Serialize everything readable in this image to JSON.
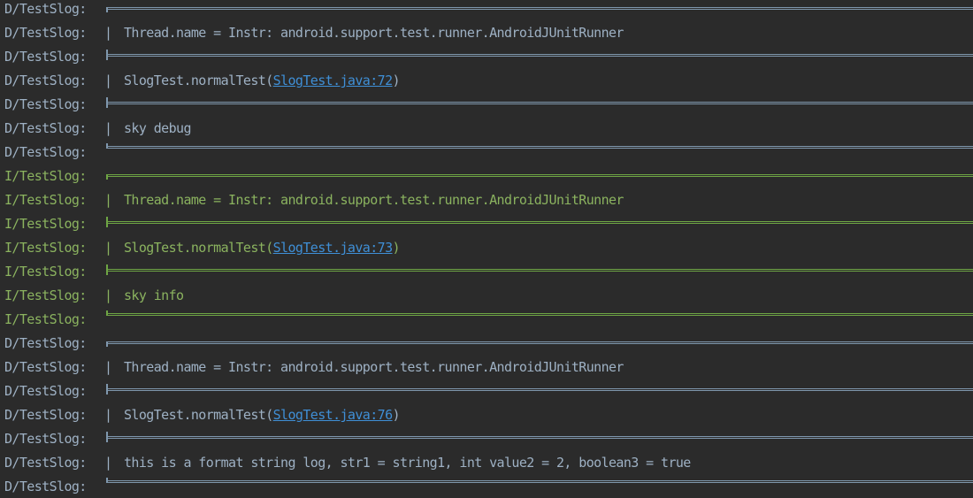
{
  "colors": {
    "background": "#2b2b2b",
    "debug_text": "#9eb1c4",
    "info_text": "#8bb35f",
    "link": "#3f8fd6"
  },
  "log_lines": [
    {
      "level": "D",
      "tag": "D/TestSlog:",
      "kind": "border-top"
    },
    {
      "level": "D",
      "tag": "D/TestSlog:",
      "kind": "text",
      "text": "Thread.name = Instr: android.support.test.runner.AndroidJUnitRunner"
    },
    {
      "level": "D",
      "tag": "D/TestSlog:",
      "kind": "border-mid"
    },
    {
      "level": "D",
      "tag": "D/TestSlog:",
      "kind": "stack",
      "text": "SlogTest.normalTest",
      "link_open": "(",
      "link": "SlogTest.java:72",
      "link_close": ")"
    },
    {
      "level": "D",
      "tag": "D/TestSlog:",
      "kind": "border-mid"
    },
    {
      "level": "D",
      "tag": "D/TestSlog:",
      "kind": "text",
      "text": "sky debug"
    },
    {
      "level": "D",
      "tag": "D/TestSlog:",
      "kind": "border-bottom"
    },
    {
      "level": "I",
      "tag": "I/TestSlog:",
      "kind": "border-top"
    },
    {
      "level": "I",
      "tag": "I/TestSlog:",
      "kind": "text",
      "text": "Thread.name = Instr: android.support.test.runner.AndroidJUnitRunner"
    },
    {
      "level": "I",
      "tag": "I/TestSlog:",
      "kind": "border-mid"
    },
    {
      "level": "I",
      "tag": "I/TestSlog:",
      "kind": "stack",
      "text": "SlogTest.normalTest",
      "link_open": "(",
      "link": "SlogTest.java:73",
      "link_close": ")"
    },
    {
      "level": "I",
      "tag": "I/TestSlog:",
      "kind": "border-mid"
    },
    {
      "level": "I",
      "tag": "I/TestSlog:",
      "kind": "text",
      "text": "sky info"
    },
    {
      "level": "I",
      "tag": "I/TestSlog:",
      "kind": "border-bottom"
    },
    {
      "level": "D",
      "tag": "D/TestSlog:",
      "kind": "border-top"
    },
    {
      "level": "D",
      "tag": "D/TestSlog:",
      "kind": "text",
      "text": "Thread.name = Instr: android.support.test.runner.AndroidJUnitRunner"
    },
    {
      "level": "D",
      "tag": "D/TestSlog:",
      "kind": "border-mid"
    },
    {
      "level": "D",
      "tag": "D/TestSlog:",
      "kind": "stack",
      "text": "SlogTest.normalTest",
      "link_open": "(",
      "link": "SlogTest.java:76",
      "link_close": ")"
    },
    {
      "level": "D",
      "tag": "D/TestSlog:",
      "kind": "border-mid"
    },
    {
      "level": "D",
      "tag": "D/TestSlog:",
      "kind": "text",
      "text": "this is a format string log, str1 = string1, int value2 = 2, boolean3 = true"
    },
    {
      "level": "D",
      "tag": "D/TestSlog:",
      "kind": "border-bottom"
    }
  ]
}
